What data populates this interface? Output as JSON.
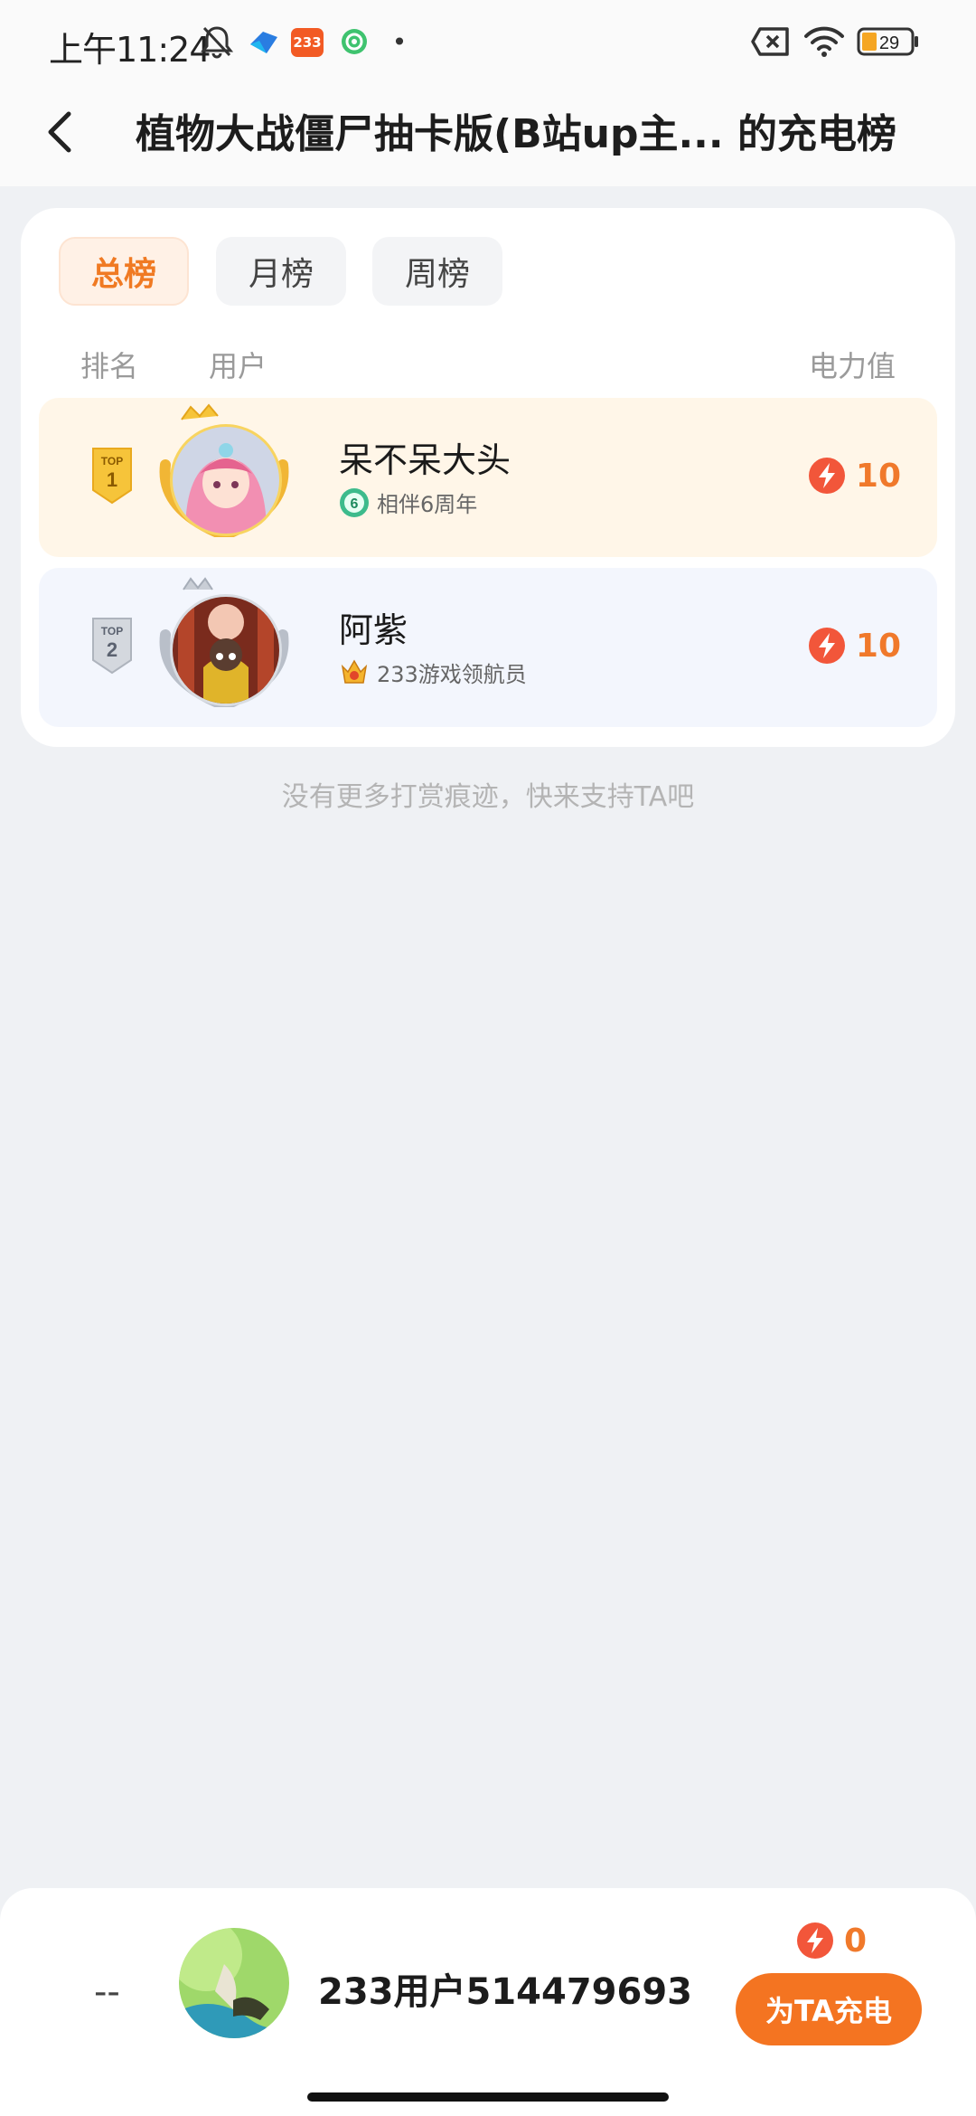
{
  "status_bar": {
    "time": "上午11:24",
    "app_badge": "233",
    "battery": "29"
  },
  "header": {
    "title": "植物大战僵尸抽卡版(B站up主...",
    "title_suffix": "的充电榜"
  },
  "tabs": [
    {
      "label": "总榜",
      "active": true
    },
    {
      "label": "月榜",
      "active": false
    },
    {
      "label": "周榜",
      "active": false
    }
  ],
  "columns": {
    "rank": "排名",
    "user": "用户",
    "power": "电力值"
  },
  "ranking": [
    {
      "rank_top": "TOP",
      "rank_num": "1",
      "name": "呆不呆大头",
      "sub_badge": "6",
      "sub_text": "相伴6周年",
      "power": "10"
    },
    {
      "rank_top": "TOP",
      "rank_num": "2",
      "name": "阿紫",
      "sub_text": "233游戏领航员",
      "power": "10"
    }
  ],
  "empty_hint": "没有更多打赏痕迹，快来支持TA吧",
  "my_entry": {
    "rank": "--",
    "name": "233用户514479693",
    "power": "0",
    "charge_label": "为TA充电"
  },
  "colors": {
    "accent": "#f47421",
    "power_text": "#f0792b",
    "row1_bg": "#fff6e8",
    "row2_bg": "#f3f6fd",
    "gold": "#f1b635",
    "silver": "#b9bfc9"
  }
}
